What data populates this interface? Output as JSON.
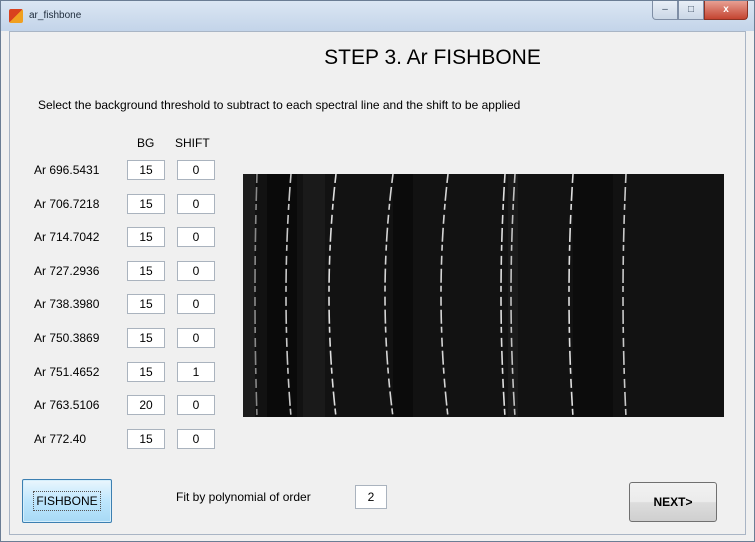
{
  "window": {
    "title": "ar_fishbone",
    "controls": {
      "minimize": "‒",
      "maximize": "□",
      "close": "x"
    }
  },
  "step_title": "STEP 3. Ar FISHBONE",
  "instructions": "Select the background threshold to subtract to each spectral line and the shift to be applied",
  "columns": {
    "bg": "BG",
    "shift": "SHIFT"
  },
  "lines": [
    {
      "label": "Ar 696.5431",
      "bg": "15",
      "shift": "0"
    },
    {
      "label": "Ar 706.7218",
      "bg": "15",
      "shift": "0"
    },
    {
      "label": "Ar 714.7042",
      "bg": "15",
      "shift": "0"
    },
    {
      "label": "Ar 727.2936",
      "bg": "15",
      "shift": "0"
    },
    {
      "label": "Ar 738.3980",
      "bg": "15",
      "shift": "0"
    },
    {
      "label": "Ar 750.3869",
      "bg": "15",
      "shift": "0"
    },
    {
      "label": "Ar 751.4652",
      "bg": "15",
      "shift": "1"
    },
    {
      "label": "Ar 763.5106",
      "bg": "20",
      "shift": "0"
    },
    {
      "label": "Ar 772.40",
      "bg": "15",
      "shift": "0"
    }
  ],
  "fishbone_button": "FISHBONE",
  "polynomial": {
    "label": "Fit by polynomial of order",
    "value": "2"
  },
  "next_button": "NEXT>"
}
